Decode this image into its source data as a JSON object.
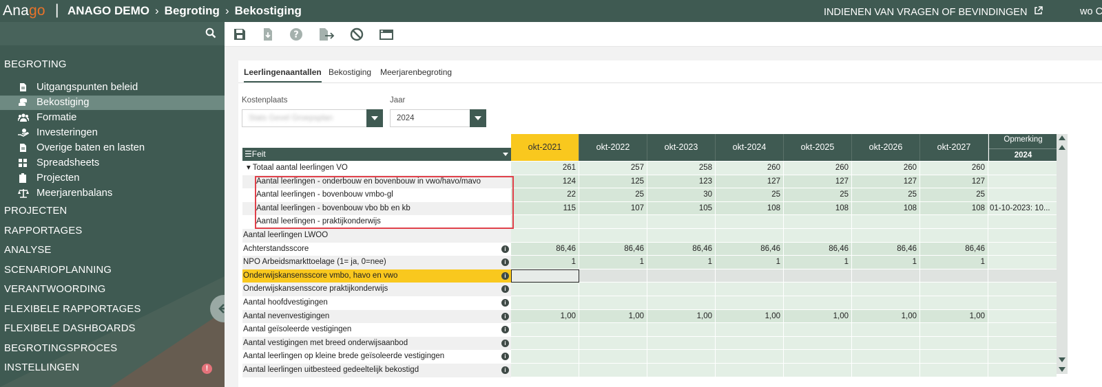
{
  "topbar": {
    "brand_pre": "Ana",
    "brand_post": "go",
    "separator": "|",
    "crumb1": "ANAGO DEMO",
    "crumb2": "Begroting",
    "crumb3": "Bekostiging",
    "chev": "›",
    "report_link": "INDIENEN VAN VRAGEN OF BEVINDINGEN",
    "user": "wo C"
  },
  "sidebar": {
    "sections": [
      {
        "label": "BEGROTING"
      },
      {
        "label": "PROJECTEN"
      },
      {
        "label": "RAPPORTAGES"
      },
      {
        "label": "ANALYSE"
      },
      {
        "label": "SCENARIOPLANNING"
      },
      {
        "label": "VERANTWOORDING"
      },
      {
        "label": "FLEXIBELE RAPPORTAGES"
      },
      {
        "label": "FLEXIBELE DASHBOARDS"
      },
      {
        "label": "BEGROTINGSPROCES"
      },
      {
        "label": "INSTELLINGEN"
      }
    ],
    "items": [
      {
        "label": "Uitgangspunten beleid",
        "icon": "document-icon"
      },
      {
        "label": "Bekostiging",
        "icon": "coins-icon"
      },
      {
        "label": "Formatie",
        "icon": "users-icon"
      },
      {
        "label": "Investeringen",
        "icon": "hand-coin-icon"
      },
      {
        "label": "Overige baten en lasten",
        "icon": "document-icon"
      },
      {
        "label": "Spreadsheets",
        "icon": "grid-icon"
      },
      {
        "label": "Projecten",
        "icon": "clipboard-icon"
      },
      {
        "label": "Meerjarenbalans",
        "icon": "balance-scale-icon"
      }
    ],
    "warning": "!"
  },
  "tabs": [
    {
      "label": "Leerlingenaantallen"
    },
    {
      "label": "Bekostiging"
    },
    {
      "label": "Meerjarenbegroting"
    }
  ],
  "filters": {
    "kostenplaats_label": "Kostenplaats",
    "kostenplaats_value": "Stats Gevel Groepsplan",
    "jaar_label": "Jaar",
    "jaar_value": "2024"
  },
  "grid": {
    "feit_header": "Feit",
    "columns": [
      "okt-2021",
      "okt-2022",
      "okt-2023",
      "okt-2024",
      "okt-2025",
      "okt-2026",
      "okt-2027"
    ],
    "remark_header": "Opmerking",
    "remark_year": "2024",
    "rows": [
      {
        "label": "▾ Totaal aantal leerlingen VO",
        "values": [
          "261",
          "257",
          "258",
          "260",
          "260",
          "260",
          "260"
        ],
        "remark": ""
      },
      {
        "label": "Aantal leerlingen - onderbouw en bovenbouw in vwo/havo/mavo",
        "values": [
          "124",
          "125",
          "123",
          "127",
          "127",
          "127",
          "127"
        ],
        "remark": ""
      },
      {
        "label": "Aantal leerlingen - bovenbouw vmbo-gl",
        "values": [
          "22",
          "25",
          "30",
          "25",
          "25",
          "25",
          "25"
        ],
        "remark": ""
      },
      {
        "label": "Aantal leerlingen - bovenbouw vbo bb en kb",
        "values": [
          "115",
          "107",
          "105",
          "108",
          "108",
          "108",
          "108"
        ],
        "remark": "01-10-2023: 10..."
      },
      {
        "label": "Aantal leerlingen - praktijkonderwijs",
        "values": [
          "",
          "",
          "",
          "",
          "",
          "",
          ""
        ],
        "remark": ""
      },
      {
        "label": "Aantal leerlingen LWOO",
        "values": [
          "",
          "",
          "",
          "",
          "",
          "",
          ""
        ],
        "remark": ""
      },
      {
        "label": "Achterstandsscore",
        "values": [
          "86,46",
          "86,46",
          "86,46",
          "86,46",
          "86,46",
          "86,46",
          "86,46"
        ],
        "remark": ""
      },
      {
        "label": "NPO Arbeidsmarkttoelage (1= ja, 0=nee)",
        "values": [
          "1",
          "1",
          "1",
          "1",
          "1",
          "1",
          "1"
        ],
        "remark": ""
      },
      {
        "label": "Onderwijskansensscore vmbo, havo en vwo",
        "values": [
          "",
          "",
          "",
          "",
          "",
          "",
          ""
        ],
        "remark": ""
      },
      {
        "label": "Onderwijskansensscore praktijkonderwijs",
        "values": [
          "",
          "",
          "",
          "",
          "",
          "",
          ""
        ],
        "remark": ""
      },
      {
        "label": "Aantal hoofdvestigingen",
        "values": [
          "",
          "",
          "",
          "",
          "",
          "",
          ""
        ],
        "remark": ""
      },
      {
        "label": "Aantal nevenvestigingen",
        "values": [
          "1,00",
          "1,00",
          "1,00",
          "1,00",
          "1,00",
          "1,00",
          "1,00"
        ],
        "remark": ""
      },
      {
        "label": "Aantal geïsoleerde vestigingen",
        "values": [
          "",
          "",
          "",
          "",
          "",
          "",
          ""
        ],
        "remark": ""
      },
      {
        "label": "Aantal vestigingen met breed onderwijsaanbod",
        "values": [
          "",
          "",
          "",
          "",
          "",
          "",
          ""
        ],
        "remark": ""
      },
      {
        "label": "Aantal leerlingen op kleine brede geïsoleerde vestigingen",
        "values": [
          "",
          "",
          "",
          "",
          "",
          "",
          ""
        ],
        "remark": ""
      },
      {
        "label": "Aantal leerlingen uitbesteed gedeeltelijk bekostigd",
        "values": [
          "",
          "",
          "",
          "",
          "",
          "",
          ""
        ],
        "remark": ""
      }
    ],
    "info_glyph": "i"
  },
  "colors": {
    "primary": "#3f5a52",
    "accent_orange": "#e8732a",
    "highlight_yellow": "#f9c81e",
    "annotation_red": "#e0404a"
  }
}
